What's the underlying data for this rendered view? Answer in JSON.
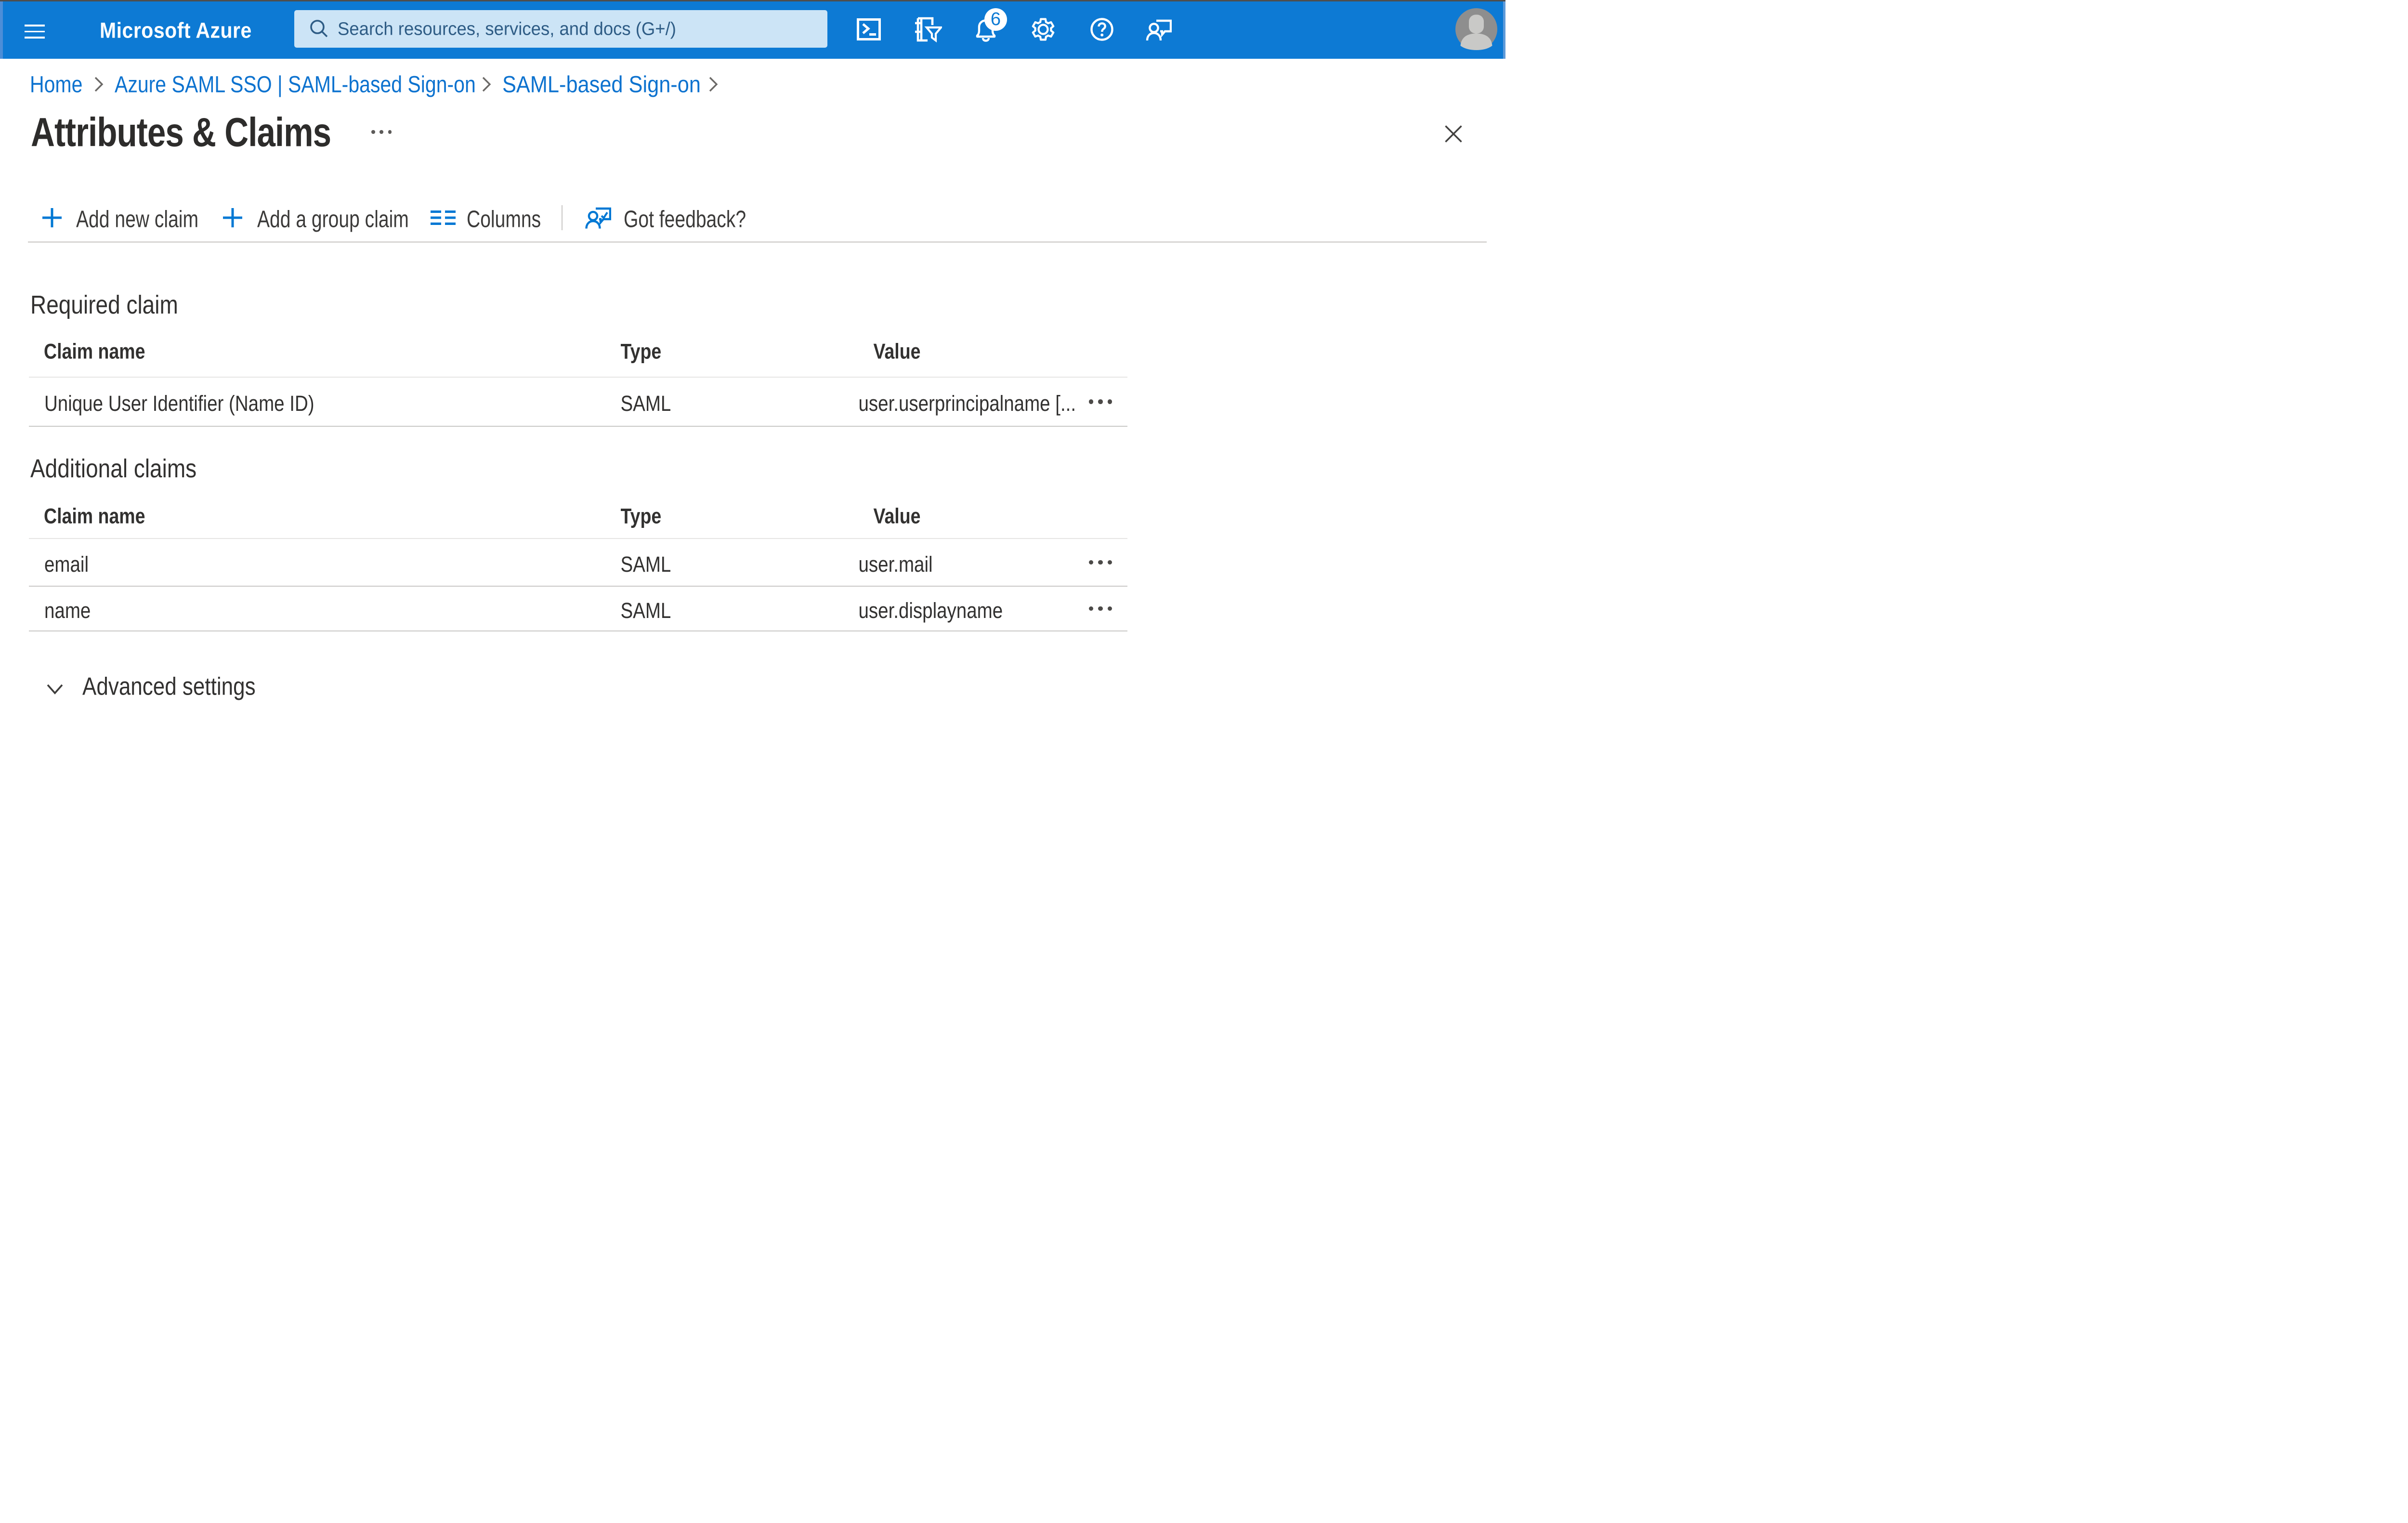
{
  "topbar": {
    "brand": "Microsoft Azure",
    "search_placeholder": "Search resources, services, and docs (G+/)",
    "notification_count": "6",
    "icon_names": [
      "hamburger-icon",
      "search-icon",
      "cloud-shell-icon",
      "directory-filter-icon",
      "bell-icon",
      "gear-icon",
      "help-icon",
      "feedback-icon",
      "avatar"
    ],
    "colors": {
      "bar": "#0d7ad4",
      "search_bg": "#cce4f6",
      "search_text": "#2e5c85"
    }
  },
  "breadcrumb": {
    "items": [
      {
        "label": "Home"
      },
      {
        "label": "Azure SAML SSO | SAML-based Sign-on"
      },
      {
        "label": "SAML-based Sign-on"
      }
    ]
  },
  "page": {
    "title": "Attributes & Claims"
  },
  "toolbar": {
    "add_new_claim": "Add new claim",
    "add_group_claim": "Add a group claim",
    "columns": "Columns",
    "got_feedback": "Got feedback?",
    "accent": "#0078d4"
  },
  "required_claim": {
    "heading": "Required claim",
    "columns": [
      "Claim name",
      "Type",
      "Value"
    ],
    "rows": [
      {
        "claim_name": "Unique User Identifier (Name ID)",
        "type": "SAML",
        "value": "user.userprincipalname [..."
      }
    ]
  },
  "additional_claims": {
    "heading": "Additional claims",
    "columns": [
      "Claim name",
      "Type",
      "Value"
    ],
    "rows": [
      {
        "claim_name": "email",
        "type": "SAML",
        "value": "user.mail"
      },
      {
        "claim_name": "name",
        "type": "SAML",
        "value": "user.displayname"
      }
    ]
  },
  "advanced": {
    "label": "Advanced settings"
  }
}
